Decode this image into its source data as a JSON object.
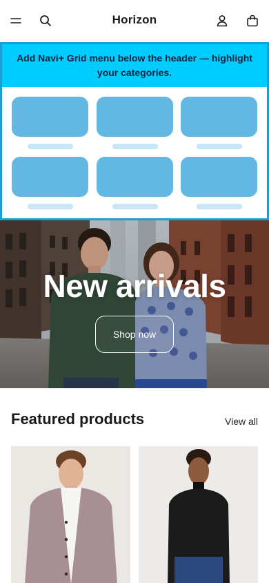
{
  "header": {
    "logo": "Horizon",
    "icons": [
      "menu-icon",
      "search-icon",
      "account-icon",
      "cart-icon"
    ]
  },
  "promo": {
    "banner_text": "Add Navi+ Grid menu below the header — highlight your categories.",
    "banner_color": "#00ccff",
    "border_color": "#1a9fd4",
    "tile_color": "#62b8e2",
    "tile_bar_color": "#c8e6f5"
  },
  "hero": {
    "title": "New arrivals",
    "button_label": "Shop now"
  },
  "featured": {
    "title": "Featured products",
    "view_all": "View all"
  }
}
